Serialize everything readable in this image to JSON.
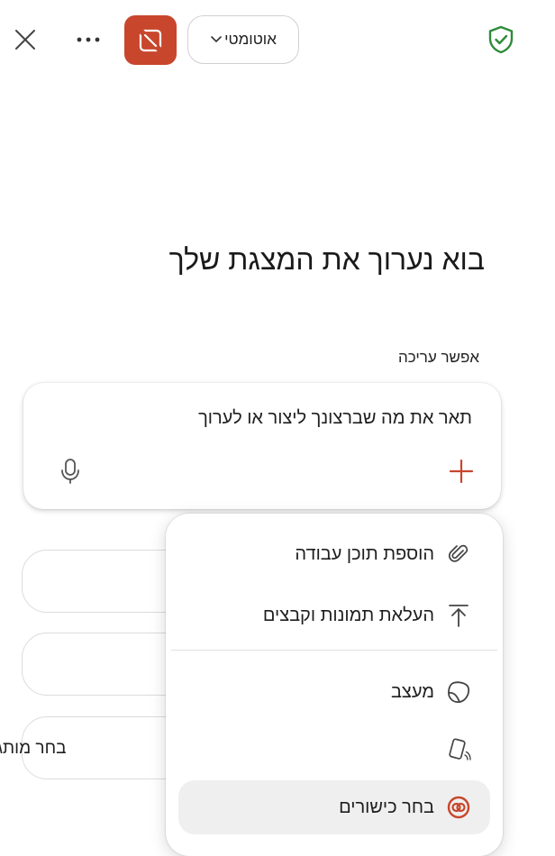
{
  "header": {
    "mode_dropdown_label": "אוטומטי",
    "icons": {
      "close": "close-icon",
      "more": "more-horizontal-icon",
      "app": "powerpoint-designer-icon",
      "dropdown": "chevron-down-icon",
      "shield": "shield-check-icon"
    },
    "colors": {
      "app_accent": "#c8462c",
      "shield": "#2e8b3a"
    }
  },
  "main": {
    "title": "בוא נערוך את המצגת שלך",
    "enable_edit_label": "אפשר עריכה",
    "prompt": {
      "placeholder": "תאר את מה שברצונך ליצור או לערוך",
      "mic_icon": "microphone-icon",
      "plus_icon": "plus-icon",
      "plus_color": "#c8462c"
    },
    "suggestion_pills": [
      {
        "label": ""
      },
      {
        "label": ""
      },
      {
        "label": "בחר מותג"
      }
    ]
  },
  "popup_menu": {
    "items": [
      {
        "label": "הוספת תוכן עבודה",
        "icon": "paperclip-icon"
      },
      {
        "label": "העלאת תמונות וקבצים",
        "icon": "upload-icon"
      },
      {
        "label": "מעצב",
        "icon": "designer-icon"
      },
      {
        "label": "",
        "icon": "device-tap-icon"
      },
      {
        "label": "בחר כישורים",
        "icon": "skills-icon",
        "highlighted": true
      }
    ]
  }
}
